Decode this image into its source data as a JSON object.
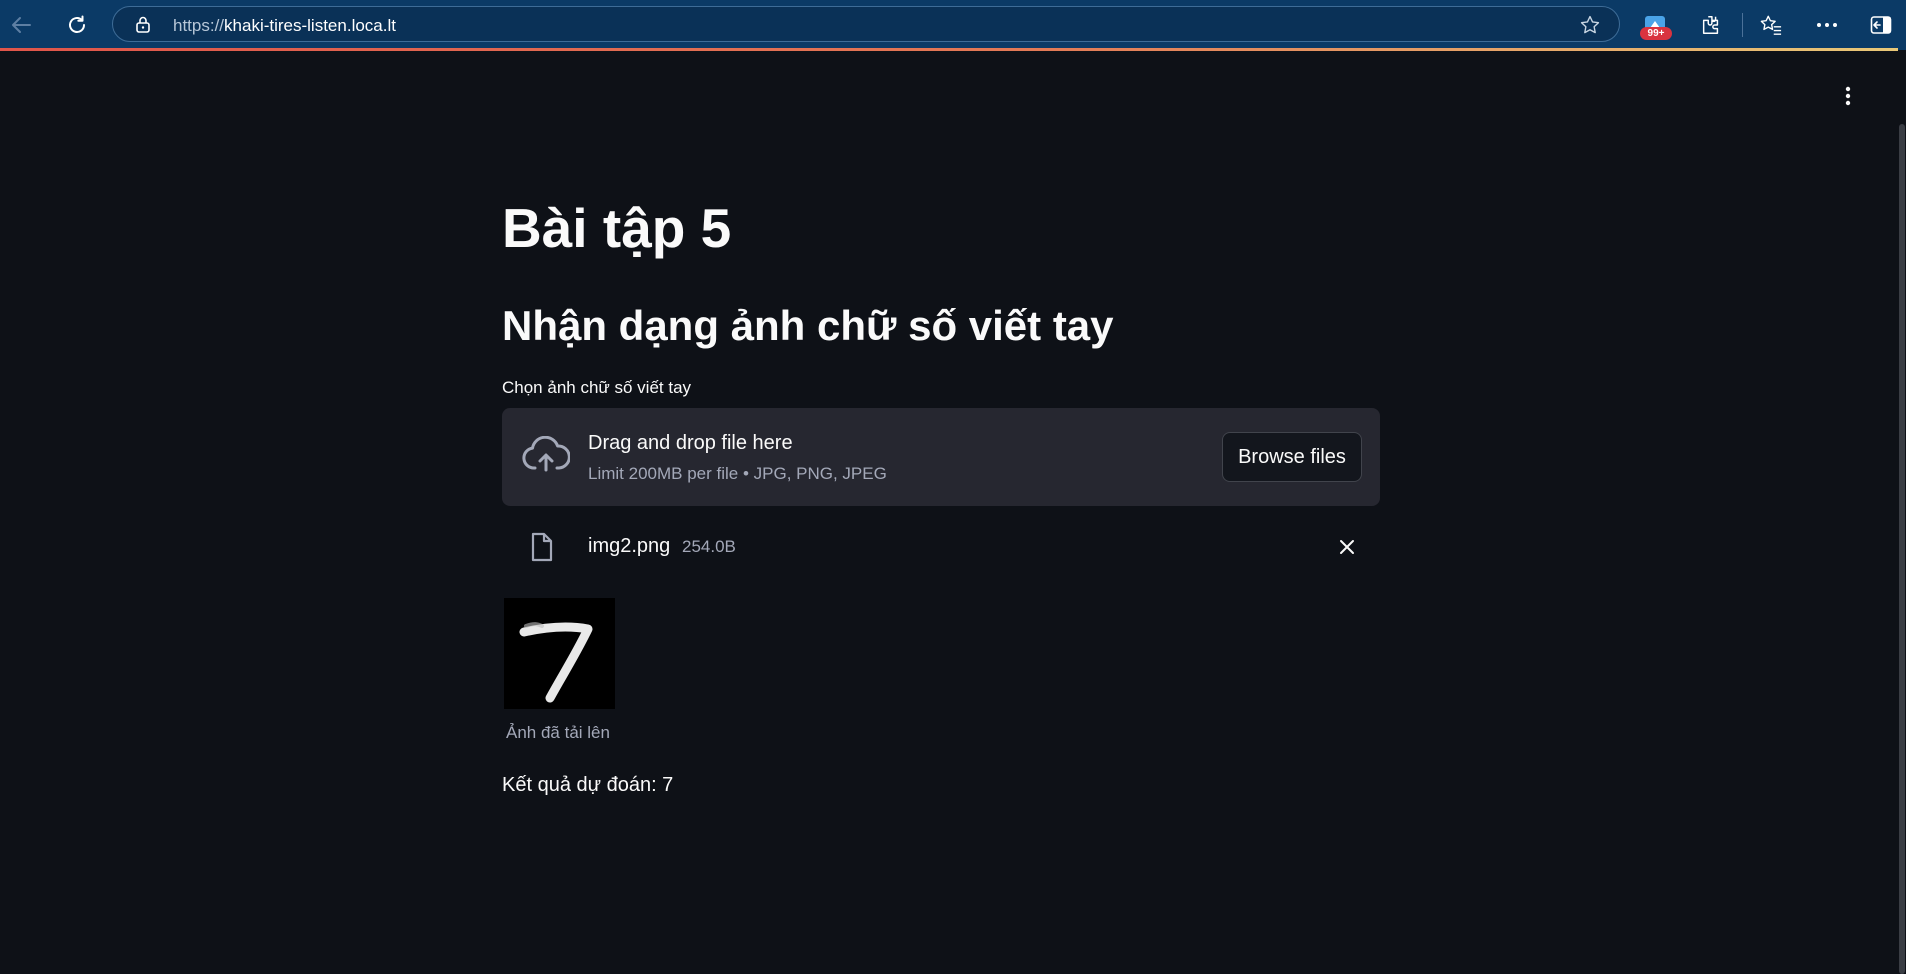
{
  "browser": {
    "url_scheme": "https://",
    "url_host": "khaki-tires-listen.loca.lt",
    "notification_badge": "99+",
    "icons": [
      "back-arrow-icon",
      "refresh-icon",
      "lock-icon",
      "star-icon",
      "profile-notification-icon",
      "extensions-icon",
      "favorites-icon",
      "more-icon",
      "sidebar-icon"
    ]
  },
  "app": {
    "title": "Bài tập 5",
    "subtitle": "Nhận dạng ảnh chữ số viết tay",
    "uploader": {
      "label": "Chọn ảnh chữ số viết tay",
      "drop_title": "Drag and drop file here",
      "drop_limit": "Limit 200MB per file • JPG, PNG, JPEG",
      "browse_label": "Browse files"
    },
    "file": {
      "name": "img2.png",
      "size": "254.0B"
    },
    "image_caption": "Ảnh đã tải lên",
    "result": "Kết quả dự đoán: 7"
  },
  "colors": {
    "background": "#0e1117",
    "dropzone": "#262730",
    "chrome": "#0b3a66",
    "muted_text": "#a3a8b8"
  }
}
